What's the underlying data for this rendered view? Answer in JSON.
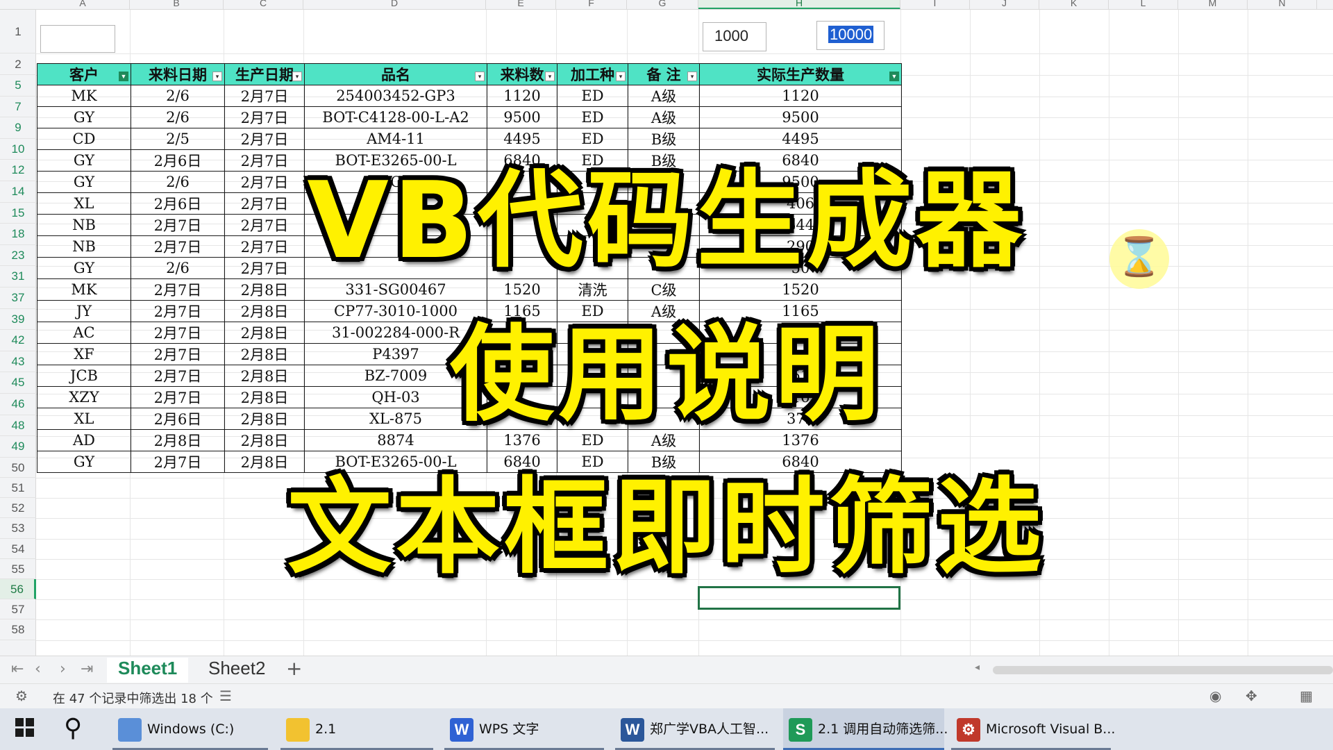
{
  "columns": [
    "A",
    "B",
    "C",
    "D",
    "E",
    "F",
    "G",
    "H",
    "I",
    "J",
    "K",
    "L",
    "M",
    "N"
  ],
  "selected_column": "H",
  "inputs": {
    "a1": "",
    "min_value": "1000",
    "max_value": "10000"
  },
  "table": {
    "headers": [
      "客户",
      "来料日期",
      "生产日期",
      "品名",
      "来料数",
      "加工种",
      "备 注",
      "实际生产数量"
    ],
    "header_filter_active": [
      true,
      false,
      false,
      false,
      false,
      false,
      false,
      true
    ],
    "rows": [
      {
        "row": "5",
        "cells": [
          "MK",
          "2/6",
          "2月7日",
          "254003452-GP3",
          "1120",
          "ED",
          "A级",
          "1120"
        ]
      },
      {
        "row": "7",
        "cells": [
          "GY",
          "2/6",
          "2月7日",
          "BOT-C4128-00-L-A2",
          "9500",
          "ED",
          "A级",
          "9500"
        ]
      },
      {
        "row": "9",
        "cells": [
          "CD",
          "2/5",
          "2月7日",
          "AM4-11",
          "4495",
          "ED",
          "B级",
          "4495"
        ],
        "red_col": 6
      },
      {
        "row": "10",
        "cells": [
          "GY",
          "2月6日",
          "2月7日",
          "BOT-E3265-00-L",
          "6840",
          "ED",
          "B级",
          "6840"
        ]
      },
      {
        "row": "12",
        "cells": [
          "GY",
          "2/6",
          "2月7日",
          "BOT",
          "",
          "",
          "",
          "9500"
        ]
      },
      {
        "row": "14",
        "cells": [
          "XL",
          "2月6日",
          "2月7日",
          "",
          "",
          "",
          "",
          "406"
        ]
      },
      {
        "row": "15",
        "cells": [
          "NB",
          "2月7日",
          "2月7日",
          "",
          "",
          "",
          "",
          "644"
        ]
      },
      {
        "row": "18",
        "cells": [
          "NB",
          "2月7日",
          "2月7日",
          "",
          "",
          "",
          "",
          "290"
        ]
      },
      {
        "row": "23",
        "cells": [
          "GY",
          "2/6",
          "2月7日",
          "",
          "",
          "",
          "",
          "50"
        ]
      },
      {
        "row": "31",
        "cells": [
          "MK",
          "2月7日",
          "2月8日",
          "331-SG00467",
          "1520",
          "清洗",
          "C级",
          "1520"
        ]
      },
      {
        "row": "37",
        "cells": [
          "JY",
          "2月7日",
          "2月8日",
          "CP77-3010-1000",
          "1165",
          "ED",
          "A级",
          "1165"
        ]
      },
      {
        "row": "39",
        "cells": [
          "AC",
          "2月7日",
          "2月8日",
          "31-002284-000-R",
          "",
          "",
          "",
          "16"
        ]
      },
      {
        "row": "42",
        "cells": [
          "XF",
          "2月7日",
          "2月8日",
          "P4397",
          "",
          "",
          "",
          "14"
        ]
      },
      {
        "row": "43",
        "cells": [
          "JCB",
          "2月7日",
          "2月8日",
          "BZ-7009",
          "",
          "",
          "",
          "51"
        ]
      },
      {
        "row": "45",
        "cells": [
          "XZY",
          "2月7日",
          "2月8日",
          "QH-03",
          "",
          "",
          "",
          "16"
        ]
      },
      {
        "row": "46",
        "cells": [
          "XL",
          "2月6日",
          "2月8日",
          "XL-875",
          "",
          "",
          "",
          "372"
        ]
      },
      {
        "row": "48",
        "cells": [
          "AD",
          "2月8日",
          "2月8日",
          "8874",
          "1376",
          "ED",
          "A级",
          "1376"
        ]
      },
      {
        "row": "49",
        "cells": [
          "GY",
          "2月7日",
          "2月8日",
          "BOT-E3265-00-L",
          "6840",
          "ED",
          "B级",
          "6840"
        ]
      }
    ]
  },
  "header_rows": [
    "1",
    "2"
  ],
  "empty_rows": [
    "50",
    "51",
    "52",
    "53",
    "54",
    "55",
    "56",
    "57",
    "58"
  ],
  "active_row": "56",
  "overlay": {
    "line1": "VB代码生成器",
    "line2": "使用说明",
    "line3": "文本框即时筛选"
  },
  "sheet_tabs": [
    {
      "label": "Sheet1",
      "active": true
    },
    {
      "label": "Sheet2",
      "active": false
    }
  ],
  "add_tab_label": "+",
  "status": {
    "text": "在 47 个记录中筛选出 18 个"
  },
  "taskbar": [
    {
      "label": "Windows (C:)",
      "icon": "drive-icon",
      "color": "#5a8fd8"
    },
    {
      "label": "2.1",
      "icon": "folder-icon",
      "color": "#f2c230"
    },
    {
      "label": "WPS 文字",
      "icon": "wps-writer-icon",
      "color": "#2f62d4",
      "glyph": "W"
    },
    {
      "label": "郑广学VBA人工智...",
      "icon": "word-icon",
      "color": "#2b579a",
      "glyph": "W"
    },
    {
      "label": "2.1 调用自动筛选筛...",
      "icon": "wps-sheet-icon",
      "color": "#1f9a58",
      "glyph": "S"
    },
    {
      "label": "Microsoft Visual B...",
      "icon": "vba-editor-icon",
      "color": "#c0392b",
      "glyph": "⚙"
    }
  ],
  "colors": {
    "header_fill": "#4fe3c5",
    "accent": "#1e8a5a",
    "overlay_text": "#fff100",
    "warning_text": "#e04040"
  }
}
